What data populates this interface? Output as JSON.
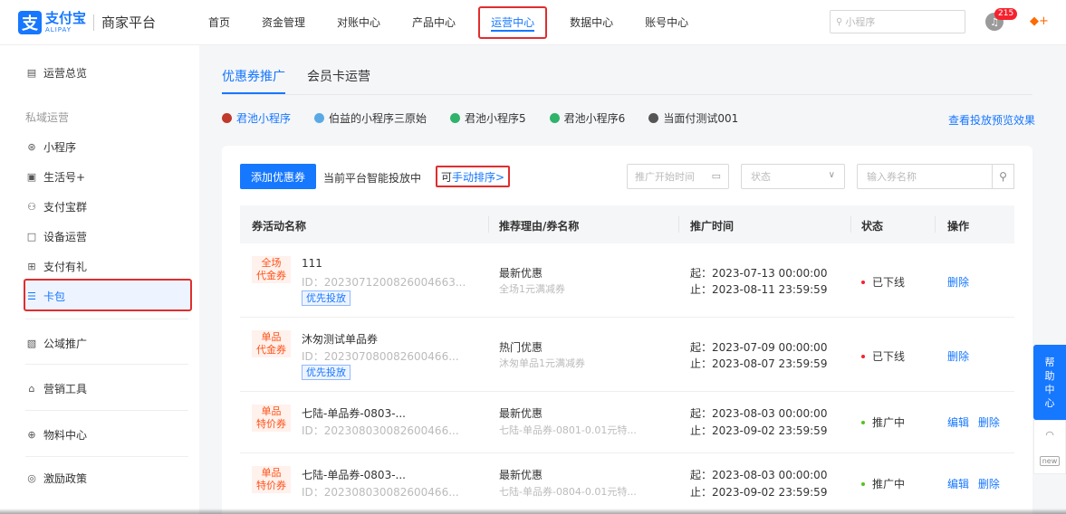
{
  "header": {
    "logo_mark": "支",
    "logo_cn": "支付宝",
    "logo_en": "ALIPAY",
    "title": "商家平台",
    "nav": [
      "首页",
      "资金管理",
      "对账中心",
      "产品中心",
      "运营中心",
      "数据中心",
      "账号中心"
    ],
    "active_nav": "运营中心",
    "search_placeholder": "小程序",
    "notification_count": "215",
    "bell_icon": "bell-icon",
    "user_icon": "user-icon"
  },
  "sidebar": {
    "overview": "运营总览",
    "group_private": "私域运营",
    "items_private": [
      "小程序",
      "生活号+",
      "支付宝群",
      "设备运营",
      "支付有礼",
      "卡包"
    ],
    "active_item": "卡包",
    "items_other": [
      "公域推广",
      "营销工具",
      "物料中心",
      "激励政策"
    ]
  },
  "main": {
    "tabs": [
      "优惠券推广",
      "会员卡运营"
    ],
    "active_tab": "优惠券推广",
    "apps": [
      {
        "label": "君池小程序",
        "color": "#c0392b",
        "active": true
      },
      {
        "label": "伯益的小程序三原始",
        "color": "#5aa9e6",
        "active": false
      },
      {
        "label": "君池小程序5",
        "color": "#2fb36a",
        "active": false
      },
      {
        "label": "君池小程序6",
        "color": "#2fb36a",
        "active": false
      },
      {
        "label": "当面付测试001",
        "color": "#555555",
        "active": false
      }
    ],
    "preview_link": "查看投放预览效果",
    "toolbar": {
      "add_button": "添加优惠券",
      "intelli_text": "当前平台智能投放中",
      "manual_prefix": "可",
      "manual_link": "手动排序>",
      "date_placeholder": "推广开始时间",
      "status_placeholder": "状态",
      "name_placeholder": "输入券名称"
    },
    "table": {
      "headers": [
        "券活动名称",
        "推荐理由/券名称",
        "推广时间",
        "状态",
        "操作"
      ],
      "rows": [
        {
          "tag1": "全场",
          "tag2": "代金券",
          "name": "111",
          "id": "ID：2023071200826004663...",
          "priority": "优先投放",
          "reason": "最新优惠",
          "sub": "全场1元满减券",
          "start": "起：2023-07-13 00:00:00",
          "end": "止：2023-08-11 23:59:59",
          "status": "已下线",
          "status_color": "#f5222d",
          "ops": [
            "删除"
          ]
        },
        {
          "tag1": "单品",
          "tag2": "代金券",
          "name": "沐匆测试单品券",
          "id": "ID：202307080082600466...",
          "priority": "优先投放",
          "reason": "热门优惠",
          "sub": "沐匆单品1元满减券",
          "start": "起：2023-07-09 00:00:00",
          "end": "止：2023-08-07 23:59:59",
          "status": "已下线",
          "status_color": "#f5222d",
          "ops": [
            "删除"
          ]
        },
        {
          "tag1": "单品",
          "tag2": "特价券",
          "name": "七陆-单品券-0803-...",
          "id": "ID：202308030082600466...",
          "priority": "",
          "reason": "最新优惠",
          "sub": "七陆-单品券-0801-0.01元特...",
          "start": "起：2023-08-03 00:00:00",
          "end": "止：2023-09-02 23:59:59",
          "status": "推广中",
          "status_color": "#52c41a",
          "ops": [
            "编辑",
            "删除"
          ]
        },
        {
          "tag1": "单品",
          "tag2": "特价券",
          "name": "七陆-单品券-0803-...",
          "id": "ID：202308030082600466...",
          "priority": "",
          "reason": "最新优惠",
          "sub": "七陆-单品券-0804-0.01元特...",
          "start": "起：2023-08-03 00:00:00",
          "end": "止：2023-09-02 23:59:59",
          "status": "推广中",
          "status_color": "#52c41a",
          "ops": [
            "编辑",
            "删除"
          ]
        }
      ]
    }
  },
  "help": {
    "chars": [
      "帮",
      "助",
      "中",
      "心"
    ],
    "new_label": "new"
  }
}
